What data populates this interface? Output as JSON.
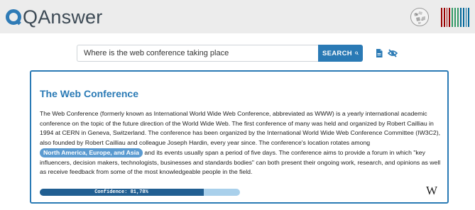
{
  "header": {
    "logo_text": "QAnswer",
    "wikidata_colors": [
      "#990000",
      "#339966",
      "#006699"
    ]
  },
  "search": {
    "value": "Where is the web conference taking place",
    "button_label": "SEARCH"
  },
  "answer": {
    "title": "The Web Conference",
    "text_before": "The Web Conference (formerly known as International World Wide Web Conference, abbreviated as WWW) is a yearly international academic conference on the topic of the future direction of the World Wide Web. The first conference of many was held and organized by Robert Cailliau in 1994 at CERN in Geneva, Switzerland. The conference has been organized by the International World Wide Web Conference Committee (IW3C2), also founded by Robert Cailliau and colleague Joseph Hardin, every year since. The conference's location rotates among ",
    "highlight": "North America, Europe, and Asia",
    "text_after": " and its events usually span a period of five days. The conference aims to provide a forum in which \"key influencers, decision makers, technologists, businesses and standards bodies\" can both present their ongoing work, research, and opinions as well as receive feedback from some of the most knowledgeable people in the field.",
    "confidence_label": "Confidence: 81,78%",
    "confidence": 0.8178,
    "source_mark": "W"
  },
  "colors": {
    "accent": "#2a7ab5",
    "highlight_bg": "#5b9bd1",
    "bar_fill": "#215f92",
    "bar_track": "#a9d0eb"
  }
}
